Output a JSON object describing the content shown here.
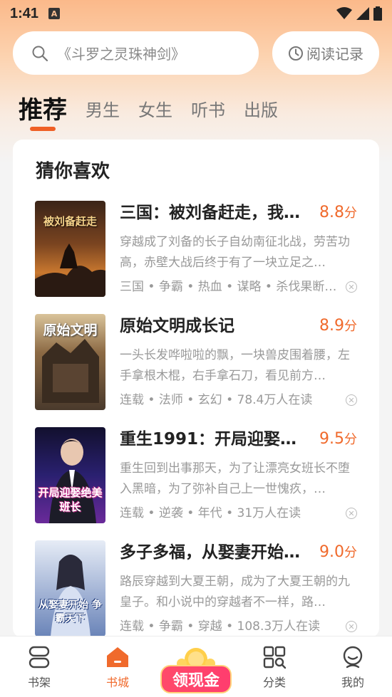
{
  "status_bar": {
    "time": "1:41",
    "notif_letter": "A"
  },
  "search": {
    "placeholder": "《斗罗之灵珠神剑》"
  },
  "history": {
    "label": "阅读记录"
  },
  "tabs": [
    {
      "label": "推荐",
      "active": true
    },
    {
      "label": "男生",
      "active": false
    },
    {
      "label": "女生",
      "active": false
    },
    {
      "label": "听书",
      "active": false
    },
    {
      "label": "出版",
      "active": false
    }
  ],
  "section": {
    "title": "猜你喜欢"
  },
  "books": [
    {
      "title": "三国：被刘备赶走，我…",
      "score": "8.8",
      "unit": "分",
      "desc": "穿越成了刘备的长子自幼南征北战，劳苦功高，赤壁大战后终于有了一块立足之…",
      "tags": "三国 • 争霸 • 热血 • 谋略 • 杀伐果断…",
      "cover_text": "被刘备赶走",
      "cover_colors": [
        "#3a2418",
        "#8b4a24",
        "#c9782f"
      ]
    },
    {
      "title": "原始文明成长记",
      "score": "8.9",
      "unit": "分",
      "desc": "一头长发哗啦啦的飘，一块兽皮围着腰，左手拿根木棍，右手拿石刀，看见前方…",
      "tags": "连载 • 法师 • 玄幻 • 78.4万人在读",
      "cover_text": "原始文明",
      "cover_colors": [
        "#4a3a2c",
        "#8c6a44",
        "#d9b98a"
      ]
    },
    {
      "title": "重生1991：开局迎娶…",
      "score": "9.5",
      "unit": "分",
      "desc": "重生回到出事那天，为了让漂亮女班长不堕入黑暗，为了弥补自己上一世愧疚，…",
      "tags": "连载 • 逆袭 • 年代 • 31万人在读",
      "cover_text": "开局迎娶绝美班长",
      "cover_colors": [
        "#1a1640",
        "#3a2b8a",
        "#c22f8a"
      ]
    },
    {
      "title": "多子多福，从娶妻开始…",
      "score": "9.0",
      "unit": "分",
      "desc": "路辰穿越到大夏王朝，成为了大夏王朝的九皇子。和小说中的穿越者不一样，路…",
      "tags": "连载 • 争霸 • 穿越 • 108.3万人在读",
      "cover_text": "从娶妻开始 争霸天下",
      "cover_colors": [
        "#cfd8ea",
        "#8ea2c8",
        "#2b4a8a"
      ]
    }
  ],
  "bottom_nav": [
    {
      "label": "书架",
      "icon": "bookshelf-icon",
      "active": false
    },
    {
      "label": "书城",
      "icon": "home-icon",
      "active": true
    },
    {
      "label": "领现金",
      "icon": "cash-reward-icon",
      "active": false
    },
    {
      "label": "分类",
      "icon": "category-icon",
      "active": false
    },
    {
      "label": "我的",
      "icon": "profile-icon",
      "active": false
    }
  ],
  "colors": {
    "accent": "#f06a2c",
    "tab_underline": "#ef5f25"
  }
}
